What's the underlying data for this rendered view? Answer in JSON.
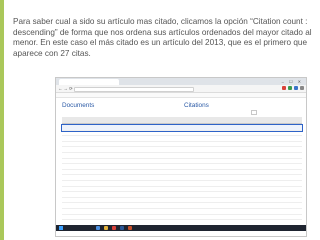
{
  "caption": "Para saber cual a sido su artículo mas citado, clicamos la opción “Citation count : descending” de forma que nos ordena sus artículos ordenados del mayor citado al menor. En este caso el más citado es un artículo del 2013, que es el primero que aparece con 27 citas.",
  "browser": {
    "tab_title": "",
    "url": "",
    "window_controls": "–  ☐  ✕",
    "bookmarks": ""
  },
  "page": {
    "documents_heading": "Documents",
    "citations_heading": "Citations",
    "documents_subline": "",
    "sort_label": "",
    "columns": {
      "document_title": "",
      "year": "",
      "years": [
        "",
        "",
        "",
        "",
        "",
        "",
        "",
        "",
        "",
        "",
        "",
        ""
      ]
    },
    "rows": [
      {
        "title": "",
        "year": "",
        "counts": [
          "",
          "",
          "",
          "",
          "",
          "",
          "",
          "",
          "",
          "",
          "",
          ""
        ]
      },
      {
        "title": "",
        "year": "",
        "counts": [
          "",
          "",
          "",
          "",
          "",
          "",
          "",
          "",
          "",
          "",
          "",
          ""
        ]
      },
      {
        "title": "",
        "year": "",
        "counts": [
          "",
          "",
          "",
          "",
          "",
          "",
          "",
          "",
          "",
          "",
          "",
          ""
        ]
      },
      {
        "title": "",
        "year": "",
        "counts": [
          "",
          "",
          "",
          "",
          "",
          "",
          "",
          "",
          "",
          "",
          "",
          ""
        ]
      },
      {
        "title": "",
        "year": "",
        "counts": [
          "",
          "",
          "",
          "",
          "",
          "",
          "",
          "",
          "",
          "",
          "",
          ""
        ]
      },
      {
        "title": "",
        "year": "",
        "counts": [
          "",
          "",
          "",
          "",
          "",
          "",
          "",
          "",
          "",
          "",
          "",
          ""
        ]
      },
      {
        "title": "",
        "year": "",
        "counts": [
          "",
          "",
          "",
          "",
          "",
          "",
          "",
          "",
          "",
          "",
          "",
          ""
        ]
      },
      {
        "title": "",
        "year": "",
        "counts": [
          "",
          "",
          "",
          "",
          "",
          "",
          "",
          "",
          "",
          "",
          "",
          ""
        ]
      },
      {
        "title": "",
        "year": "",
        "counts": [
          "",
          "",
          "",
          "",
          "",
          "",
          "",
          "",
          "",
          "",
          "",
          ""
        ]
      },
      {
        "title": "",
        "year": "",
        "counts": [
          "",
          "",
          "",
          "",
          "",
          "",
          "",
          "",
          "",
          "",
          "",
          ""
        ]
      },
      {
        "title": "",
        "year": "",
        "counts": [
          "",
          "",
          "",
          "",
          "",
          "",
          "",
          "",
          "",
          "",
          "",
          ""
        ]
      },
      {
        "title": "",
        "year": "",
        "counts": [
          "",
          "",
          "",
          "",
          "",
          "",
          "",
          "",
          "",
          "",
          "",
          ""
        ]
      },
      {
        "title": "",
        "year": "",
        "counts": [
          "",
          "",
          "",
          "",
          "",
          "",
          "",
          "",
          "",
          "",
          "",
          ""
        ]
      },
      {
        "title": "",
        "year": "",
        "counts": [
          "",
          "",
          "",
          "",
          "",
          "",
          "",
          "",
          "",
          "",
          "",
          ""
        ]
      },
      {
        "title": "",
        "year": "",
        "counts": [
          "",
          "",
          "",
          "",
          "",
          "",
          "",
          "",
          "",
          "",
          "",
          ""
        ]
      },
      {
        "title": "",
        "year": "",
        "counts": [
          "",
          "",
          "",
          "",
          "",
          "",
          "",
          "",
          "",
          "",
          "",
          ""
        ]
      },
      {
        "title": "",
        "year": "",
        "counts": [
          "",
          "",
          "",
          "",
          "",
          "",
          "",
          "",
          "",
          "",
          "",
          ""
        ]
      },
      {
        "title": "",
        "year": "",
        "counts": [
          "",
          "",
          "",
          "",
          "",
          "",
          "",
          "",
          "",
          "",
          "",
          ""
        ]
      },
      {
        "title": "",
        "year": "",
        "counts": [
          "",
          "",
          "",
          "",
          "",
          "",
          "",
          "",
          "",
          "",
          "",
          ""
        ]
      }
    ],
    "highlighted_row": 0
  },
  "taskbar": {
    "clock": ""
  },
  "colors": {
    "slide_accent": "#aac85a",
    "link_blue": "#2b5aa6",
    "highlight_border": "#2e63c8",
    "taskbar": "#1f2430"
  }
}
